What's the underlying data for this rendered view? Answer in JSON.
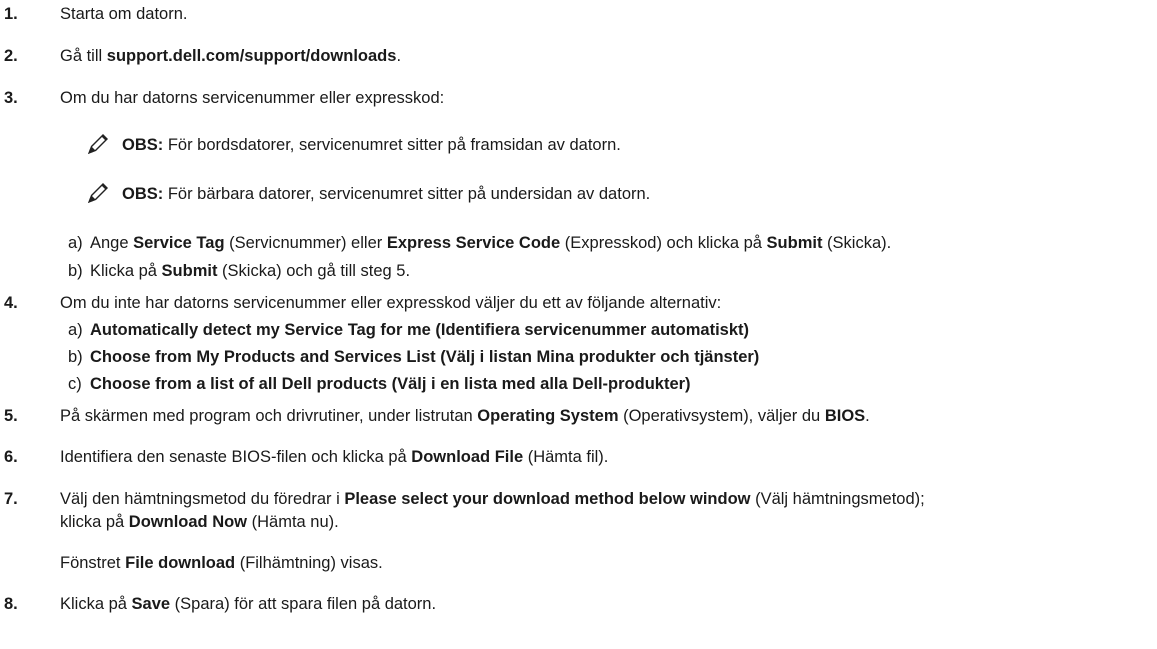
{
  "steps": {
    "s1": {
      "num": "1.",
      "text": "Starta om datorn."
    },
    "s2": {
      "num": "2.",
      "pre": "Gå till ",
      "link": "support.dell.com/support/downloads",
      "post": "."
    },
    "s3": {
      "num": "3.",
      "text": "Om du har datorns servicenummer eller expresskod:"
    },
    "s4": {
      "num": "4.",
      "text": "Om du inte har datorns servicenummer eller expresskod väljer du ett av följande alternativ:"
    },
    "s5": {
      "num": "5.",
      "t1": "På skärmen med program och drivrutiner, under listrutan ",
      "b1": "Operating System",
      "t2": " (Operativsystem), väljer du ",
      "b2": "BIOS",
      "t3": "."
    },
    "s6": {
      "num": "6.",
      "t1": "Identifiera den senaste BIOS-filen och klicka på ",
      "b1": "Download File",
      "t2": " (Hämta fil)."
    },
    "s7": {
      "num": "7.",
      "t1": "Välj den hämtningsmetod du föredrar i ",
      "b1": "Please select your download method below window",
      "t2": " (Välj hämtningsmetod);",
      "l2t1": "klicka på ",
      "l2b1": "Download Now",
      "l2t2": " (Hämta nu).",
      "l3t1": "Fönstret ",
      "l3b1": "File download",
      "l3t2": " (Filhämtning) visas."
    },
    "s8": {
      "num": "8.",
      "t1": "Klicka på ",
      "b1": "Save",
      "t2": " (Spara) för att spara filen på datorn."
    }
  },
  "notes": {
    "n1": {
      "label": "OBS:",
      "text": " För bordsdatorer, servicenumret sitter på framsidan av datorn."
    },
    "n2": {
      "label": "OBS:",
      "text": " För bärbara datorer, servicenumret sitter på undersidan av datorn."
    }
  },
  "substeps3": {
    "a": {
      "letter": "a)",
      "t1": "Ange ",
      "b1": "Service Tag",
      "t2": " (Servicnummer) eller ",
      "b2": "Express Service Code",
      "t3": " (Expresskod) och klicka på ",
      "b3": "Submit",
      "t4": " (Skicka)."
    },
    "b": {
      "letter": "b)",
      "t1": "Klicka på ",
      "b1": "Submit",
      "t2": " (Skicka) och gå till steg 5."
    }
  },
  "substeps4": {
    "a": {
      "letter": "a)",
      "text": "Automatically detect my Service Tag for me (Identifiera servicenummer automatiskt)"
    },
    "b": {
      "letter": "b)",
      "text": "Choose from My Products and Services List (Välj i listan Mina produkter och tjänster)"
    },
    "c": {
      "letter": "c)",
      "text": "Choose from a list of all Dell products (Välj i en lista med alla Dell-produkter)"
    }
  },
  "icons": {
    "note": "pencil-note-icon"
  }
}
